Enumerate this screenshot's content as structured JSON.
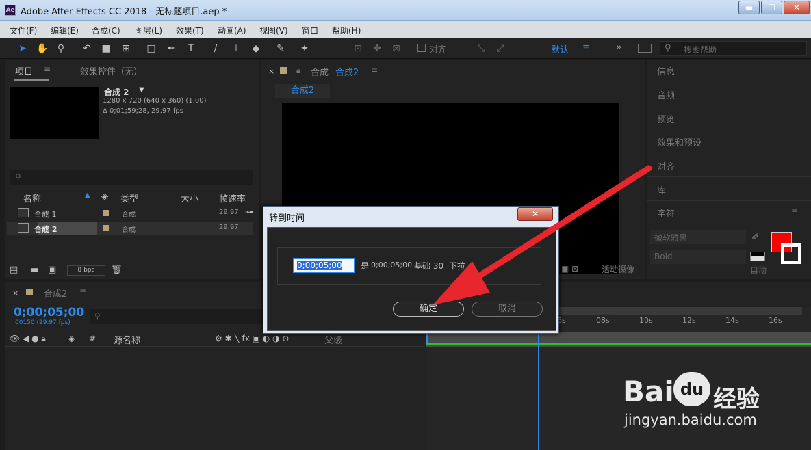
{
  "window": {
    "app_icon": "Ae",
    "title": "Adobe After Effects CC 2018 - 无标题项目.aep *",
    "minimize": "▬",
    "maximize": "☐",
    "close": "✕"
  },
  "menu": [
    "文件(F)",
    "编辑(E)",
    "合成(C)",
    "图层(L)",
    "效果(T)",
    "动画(A)",
    "视图(V)",
    "窗口",
    "帮助(H)"
  ],
  "toolbar": {
    "align_label": "对齐",
    "workspace": "默认",
    "search_placeholder": "搜索帮助"
  },
  "project_panel": {
    "tab_project": "项目",
    "tab_effects": "效果控件（无）",
    "comp_name": "合成 2",
    "comp_res": "1280 x 720  (640 x 360) (1.00)",
    "comp_duration": "Δ 0;01;59;28, 29.97 fps",
    "columns": [
      "名称",
      "类型",
      "大小",
      "帧速率"
    ],
    "rows": [
      {
        "name": "合成 1",
        "type": "合成",
        "fps": "29.97"
      },
      {
        "name": "合成 2",
        "type": "合成",
        "fps": "29.97"
      }
    ],
    "bpc": "8 bpc"
  },
  "comp_panel": {
    "tab_prefix": "合成",
    "tab_name": "合成2",
    "breadcrumb": "合成2",
    "active_camera": "活动摄像"
  },
  "right_panels": [
    "信息",
    "音频",
    "预览",
    "效果和预设",
    "对齐",
    "库",
    "字符"
  ],
  "character": {
    "font": "微软雅黑",
    "style": "Bold",
    "auto_label": "自动"
  },
  "timeline": {
    "tab_name": "合成2",
    "timecode": "0;00;05;00",
    "frames": "00150 (29.97 fps)",
    "source_name_col": "源名称",
    "parent_col": "父级",
    "ruler": [
      "6s",
      "08s",
      "10s",
      "12s",
      "14s",
      "16s"
    ]
  },
  "dialog": {
    "title": "转到时间",
    "close": "✕",
    "input_value": "0;00;05;00",
    "info_is": "是",
    "info_timecode": "0;00;05;00",
    "info_base": "基础 30",
    "info_drop": "下拉",
    "ok": "确定",
    "cancel": "取消"
  },
  "watermark": {
    "brand_left": "Bai",
    "brand_mid": "du",
    "brand_right": "经验",
    "url": "jingyan.baidu.com"
  },
  "colors": {
    "accent_blue": "#2d8ceb",
    "arrow_red": "#e8262d",
    "swatch_red": "#ff0000",
    "label_tan": "#b5a27a"
  }
}
